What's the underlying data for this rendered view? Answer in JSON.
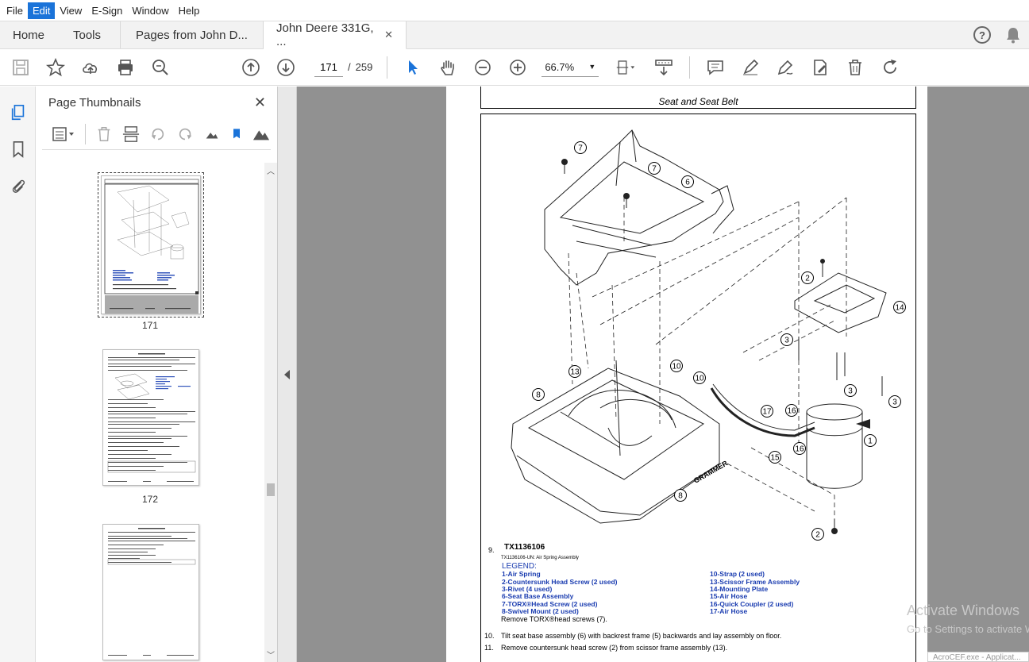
{
  "menu": [
    "File",
    "Edit",
    "View",
    "E-Sign",
    "Window",
    "Help"
  ],
  "active_menu": "Edit",
  "tabs": {
    "home": "Home",
    "tools": "Tools",
    "doc1": "Pages from John D...",
    "doc2": "John Deere 331G, ...",
    "close": "✕"
  },
  "toolbar": {
    "current_page": "171",
    "separator": "/",
    "total_pages": "259",
    "zoom": "66.7%"
  },
  "panel": {
    "title": "Page Thumbnails",
    "close": "✕",
    "thumbnails": [
      {
        "label": "171"
      },
      {
        "label": "172"
      },
      {
        "label": ""
      }
    ]
  },
  "document": {
    "header": "Seat and Seat Belt",
    "step9": "9.",
    "figure_id": "TX1136106",
    "figure_caption": "TX1136106-UN: Air Spring Assembly",
    "legend_heading": "LEGEND:",
    "legend_left": [
      "1-Air Spring",
      "2-Countersunk Head Screw (2 used)",
      "3-Rivet (4 used)",
      "6-Seat Base Assembly",
      "7-TORX®Head Screw (2 used)",
      "8-Swivel Mount (2 used)"
    ],
    "legend_right": [
      "10-Strap (2 used)",
      "13-Scissor Frame Assembly",
      "14-Mounting Plate",
      "15-Air Hose",
      "16-Quick Coupler (2 used)",
      "17-Air Hose"
    ],
    "remove_line": "Remove TORX®head screws (7).",
    "step10_num": "10.",
    "step10": "Tilt seat base assembly (6) with backrest frame (5) backwards and lay assembly on floor.",
    "step11_num": "11.",
    "step11": "Remove countersunk head screw (2) from scissor frame assembly (13).",
    "callouts": [
      "7",
      "7",
      "6",
      "2",
      "14",
      "3",
      "13",
      "10",
      "10",
      "8",
      "3",
      "3",
      "17",
      "16",
      "1",
      "15",
      "16",
      "8",
      "2"
    ]
  },
  "watermark": {
    "line1": "Activate Windows",
    "line2": "Go to Settings to activate Windows."
  },
  "taskbar_hint": "AcroCEF.exe - Applicat..."
}
